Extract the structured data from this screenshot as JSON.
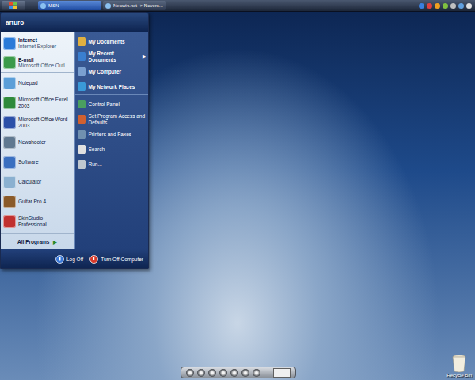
{
  "taskbar": {
    "tasks": [
      {
        "label": "MSN",
        "selected": true
      },
      {
        "label": "Neowin.net -> Novem...",
        "selected": false
      }
    ]
  },
  "start_menu": {
    "user": "arturo",
    "programs": [
      {
        "title": "Internet",
        "subtitle": "Internet Explorer",
        "kind": "pinned"
      },
      {
        "title": "E-mail",
        "subtitle": "Microsoft Office Outl...",
        "kind": "pinned"
      },
      {
        "title": "Notepad",
        "kind": "recent"
      },
      {
        "title": "Microsoft Office Excel 2003",
        "kind": "recent"
      },
      {
        "title": "Microsoft Office Word 2003",
        "kind": "recent"
      },
      {
        "title": "Newshooter",
        "kind": "recent"
      },
      {
        "title": "Software",
        "kind": "recent"
      },
      {
        "title": "Calculator",
        "kind": "recent"
      },
      {
        "title": "Guitar Pro 4",
        "kind": "recent"
      },
      {
        "title": "SkinStudio Professional",
        "kind": "recent"
      }
    ],
    "all_programs": {
      "label": "All Programs",
      "arrow": "▶"
    },
    "places": [
      {
        "label": "My Documents",
        "kind": "primary"
      },
      {
        "label": "My Recent Documents",
        "kind": "primary",
        "arrow": "▶"
      },
      {
        "label": "My Computer",
        "kind": "primary"
      },
      {
        "label": "My Network Places",
        "kind": "primary"
      },
      {
        "label": "Control Panel",
        "kind": "secondary"
      },
      {
        "label": "Set Program Access and Defaults",
        "kind": "secondary"
      },
      {
        "label": "Printers and Faxes",
        "kind": "secondary"
      },
      {
        "label": "Search",
        "kind": "secondary"
      },
      {
        "label": "Run...",
        "kind": "secondary"
      }
    ],
    "log_off": "Log Off",
    "turn_off": "Turn Off Computer"
  },
  "desktop_icons": [
    {
      "label": "Recycle Bin"
    }
  ]
}
